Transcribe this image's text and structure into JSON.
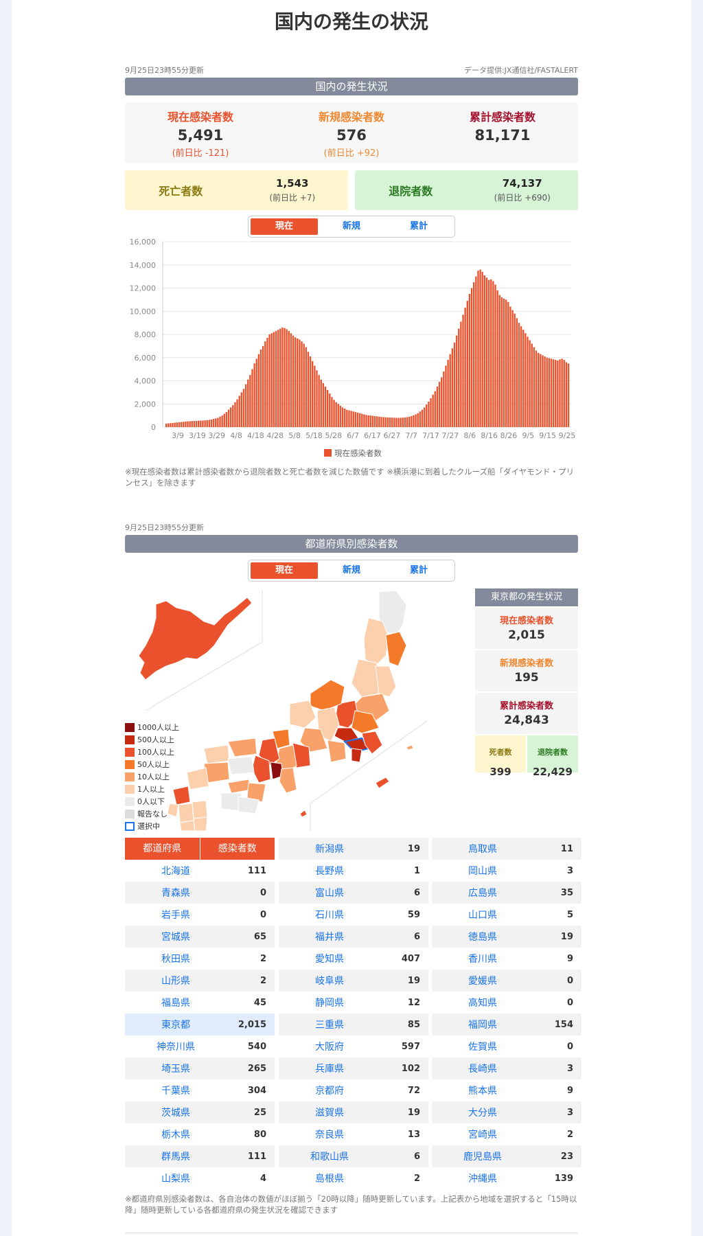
{
  "page_title": "国内の発生の状況",
  "national": {
    "updated": "9月25日23時55分更新",
    "source": "データ提供:JX通信社/FASTALERT",
    "section_title": "国内の発生状況",
    "current": {
      "label": "現在感染者数",
      "value": "5,491",
      "diff": "(前日比 -121)"
    },
    "new": {
      "label": "新規感染者数",
      "value": "576",
      "diff": "(前日比 +92)"
    },
    "total": {
      "label": "累計感染者数",
      "value": "81,171"
    },
    "deaths": {
      "label": "死亡者数",
      "value": "1,543",
      "diff": "(前日比 +7)"
    },
    "recovered": {
      "label": "退院者数",
      "value": "74,137",
      "diff": "(前日比 +690)"
    },
    "tabs": [
      "現在",
      "新規",
      "累計"
    ],
    "legend_label": "現在感染者数",
    "note": "※現在感染者数は累計感染者数から退院者数と死亡者数を減じた数値です ※横浜港に到着したクルーズ船「ダイヤモンド・プリンセス」を除きます"
  },
  "chart_data": {
    "type": "bar",
    "ylim": [
      0,
      16000
    ],
    "yticks": [
      "0",
      "2,000",
      "4,000",
      "6,000",
      "8,000",
      "10,000",
      "12,000",
      "14,000",
      "16,000"
    ],
    "xticks": [
      "3/9",
      "3/19",
      "3/29",
      "4/8",
      "4/18",
      "4/28",
      "5/8",
      "5/18",
      "5/28",
      "6/7",
      "6/17",
      "6/27",
      "7/7",
      "7/17",
      "7/27",
      "8/6",
      "8/16",
      "8/26",
      "9/5",
      "9/15",
      "9/25"
    ],
    "series": [
      {
        "name": "現在感染者数",
        "color": "#e9522d",
        "values": [
          300,
          320,
          340,
          360,
          380,
          400,
          420,
          440,
          460,
          480,
          500,
          510,
          520,
          530,
          540,
          550,
          560,
          570,
          580,
          600,
          620,
          650,
          700,
          750,
          800,
          900,
          1000,
          1150,
          1300,
          1500,
          1700,
          1900,
          2150,
          2400,
          2700,
          3000,
          3300,
          3700,
          4100,
          4500,
          5000,
          5500,
          5900,
          6300,
          6700,
          7000,
          7400,
          7700,
          8000,
          8100,
          8200,
          8300,
          8400,
          8500,
          8600,
          8550,
          8450,
          8300,
          8100,
          7900,
          7750,
          7650,
          7550,
          7400,
          7200,
          6900,
          6500,
          6100,
          5700,
          5300,
          4900,
          4500,
          4100,
          3800,
          3500,
          3200,
          2900,
          2600,
          2350,
          2150,
          2000,
          1850,
          1700,
          1600,
          1500,
          1450,
          1400,
          1350,
          1300,
          1250,
          1200,
          1150,
          1100,
          1050,
          1020,
          1000,
          980,
          950,
          930,
          900,
          880,
          860,
          850,
          840,
          830,
          820,
          810,
          800,
          800,
          810,
          820,
          840,
          860,
          900,
          950,
          1020,
          1100,
          1200,
          1350,
          1500,
          1700,
          1950,
          2200,
          2500,
          2800,
          3100,
          3500,
          3900,
          4300,
          4800,
          5300,
          5800,
          6300,
          6800,
          7300,
          7900,
          8500,
          9100,
          9700,
          10300,
          10900,
          11500,
          12000,
          12500,
          13000,
          13500,
          13600,
          13400,
          13100,
          12900,
          12700,
          12750,
          12600,
          12300,
          11800,
          11400,
          11200,
          11100,
          11000,
          10800,
          10400,
          10100,
          9800,
          9400,
          9000,
          8700,
          8400,
          8100,
          7800,
          7500,
          7200,
          6900,
          6600,
          6400,
          6300,
          6200,
          6100,
          6000,
          5950,
          5900,
          5850,
          5800,
          5750,
          5850,
          5900,
          5800,
          5600,
          5491
        ]
      }
    ]
  },
  "prefecture": {
    "updated": "9月25日23時55分更新",
    "section_title": "都道府県別感染者数",
    "tabs": [
      "現在",
      "新規",
      "累計"
    ],
    "legend": [
      {
        "label": "1000人以上",
        "color": "#8b0e0e"
      },
      {
        "label": "500人以上",
        "color": "#c62b12"
      },
      {
        "label": "100人以上",
        "color": "#e9522d"
      },
      {
        "label": "50人以上",
        "color": "#f47a2a"
      },
      {
        "label": "10人以上",
        "color": "#f8a26a"
      },
      {
        "label": "1人以上",
        "color": "#fcd0ad"
      },
      {
        "label": "0人以下",
        "color": "#ebebeb"
      },
      {
        "label": "報告なし",
        "color": "#dcdcdc"
      },
      {
        "label": "選択中",
        "color": "#ffffff"
      }
    ],
    "tokyo": {
      "title": "東京都の発生状況",
      "current": {
        "label": "現在感染者数",
        "value": "2,015"
      },
      "new": {
        "label": "新規感染者数",
        "value": "195"
      },
      "total": {
        "label": "累計感染者数",
        "value": "24,843"
      },
      "deaths": {
        "label": "死者数",
        "value": "399"
      },
      "recovered": {
        "label": "退院者数",
        "value": "22,429"
      }
    },
    "table_header": [
      "都道府県",
      "感染者数"
    ],
    "columns": [
      [
        [
          "北海道",
          "111"
        ],
        [
          "青森県",
          "0"
        ],
        [
          "岩手県",
          "0"
        ],
        [
          "宮城県",
          "65"
        ],
        [
          "秋田県",
          "2"
        ],
        [
          "山形県",
          "2"
        ],
        [
          "福島県",
          "45"
        ],
        [
          "東京都",
          "2,015"
        ],
        [
          "神奈川県",
          "540"
        ],
        [
          "埼玉県",
          "265"
        ],
        [
          "千葉県",
          "304"
        ],
        [
          "茨城県",
          "25"
        ],
        [
          "栃木県",
          "80"
        ],
        [
          "群馬県",
          "111"
        ],
        [
          "山梨県",
          "4"
        ]
      ],
      [
        [
          "新潟県",
          "19"
        ],
        [
          "長野県",
          "1"
        ],
        [
          "富山県",
          "6"
        ],
        [
          "石川県",
          "59"
        ],
        [
          "福井県",
          "6"
        ],
        [
          "愛知県",
          "407"
        ],
        [
          "岐阜県",
          "19"
        ],
        [
          "静岡県",
          "12"
        ],
        [
          "三重県",
          "85"
        ],
        [
          "大阪府",
          "597"
        ],
        [
          "兵庫県",
          "102"
        ],
        [
          "京都府",
          "72"
        ],
        [
          "滋賀県",
          "19"
        ],
        [
          "奈良県",
          "13"
        ],
        [
          "和歌山県",
          "6"
        ],
        [
          "島根県",
          "2"
        ]
      ],
      [
        [
          "鳥取県",
          "11"
        ],
        [
          "岡山県",
          "3"
        ],
        [
          "広島県",
          "35"
        ],
        [
          "山口県",
          "5"
        ],
        [
          "徳島県",
          "19"
        ],
        [
          "香川県",
          "9"
        ],
        [
          "愛媛県",
          "0"
        ],
        [
          "高知県",
          "0"
        ],
        [
          "福岡県",
          "154"
        ],
        [
          "佐賀県",
          "0"
        ],
        [
          "長崎県",
          "3"
        ],
        [
          "熊本県",
          "9"
        ],
        [
          "大分県",
          "3"
        ],
        [
          "宮崎県",
          "2"
        ],
        [
          "鹿児島県",
          "23"
        ],
        [
          "沖縄県",
          "139"
        ]
      ]
    ],
    "note": "※都道府県別感染者数は、各自治体の数値がほぼ揃う「20時以降」随時更新しています。上記表から地域を選択すると「15時以降」随時更新している各都道府県の発生状況を確認できます"
  }
}
